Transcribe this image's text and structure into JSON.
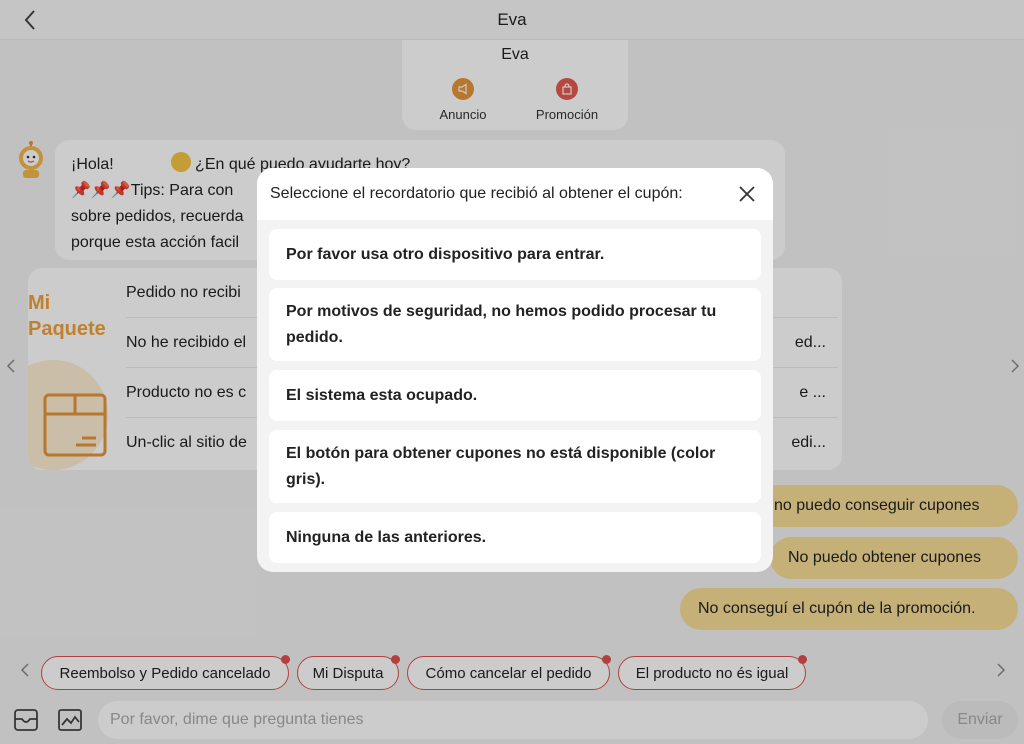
{
  "header": {
    "title": "Eva"
  },
  "eva_card": {
    "title": "Eva",
    "actions": [
      {
        "label": "Anuncio",
        "icon": "megaphone-icon",
        "color": "#e6953a"
      },
      {
        "label": "Promoción",
        "icon": "shopping-bag-icon",
        "color": "#e55a4f"
      }
    ]
  },
  "bot_message": {
    "line1_a": "¡Hola!",
    "line1_b": "¿En qué puedo ayudarte hoy?",
    "line2": "Tips: Para con",
    "line3": "sobre pedidos, recuerda",
    "line4": "porque esta acción facil"
  },
  "faq": {
    "side_line1": "Mi",
    "side_line2": "Paquete",
    "items": [
      {
        "label": "Pedido no recibi",
        "tail": ""
      },
      {
        "label": "No he recibido el",
        "tail": "ed..."
      },
      {
        "label": "Producto no es c",
        "tail": "e ..."
      },
      {
        "label": "Un-clic al sitio de",
        "tail": "edi..."
      }
    ]
  },
  "user_messages": [
    "no puedo conseguir cupones",
    "No puedo obtener cupones",
    "No conseguí el cupón de la promoción."
  ],
  "quick_replies": [
    "Reembolso y Pedido cancelado",
    "Mi Disputa",
    "Cómo cancelar el pedido",
    "El producto no és igual"
  ],
  "composer": {
    "placeholder": "Por favor, dime que pregunta tienes",
    "send_label": "Enviar"
  },
  "modal": {
    "title": "Seleccione el recordatorio que recibió al obtener el cupón:",
    "options": [
      "Por favor usa otro dispositivo para entrar.",
      "Por motivos de seguridad, no hemos podido procesar tu pedido.",
      "El sistema esta ocupado.",
      "El botón para obtener cupones no está disponible (color gris).",
      "Ninguna de las anteriores."
    ]
  },
  "colors": {
    "accent": "#f0a23a",
    "user_bubble": "#f7dd97",
    "chip_border": "#e0504f"
  }
}
